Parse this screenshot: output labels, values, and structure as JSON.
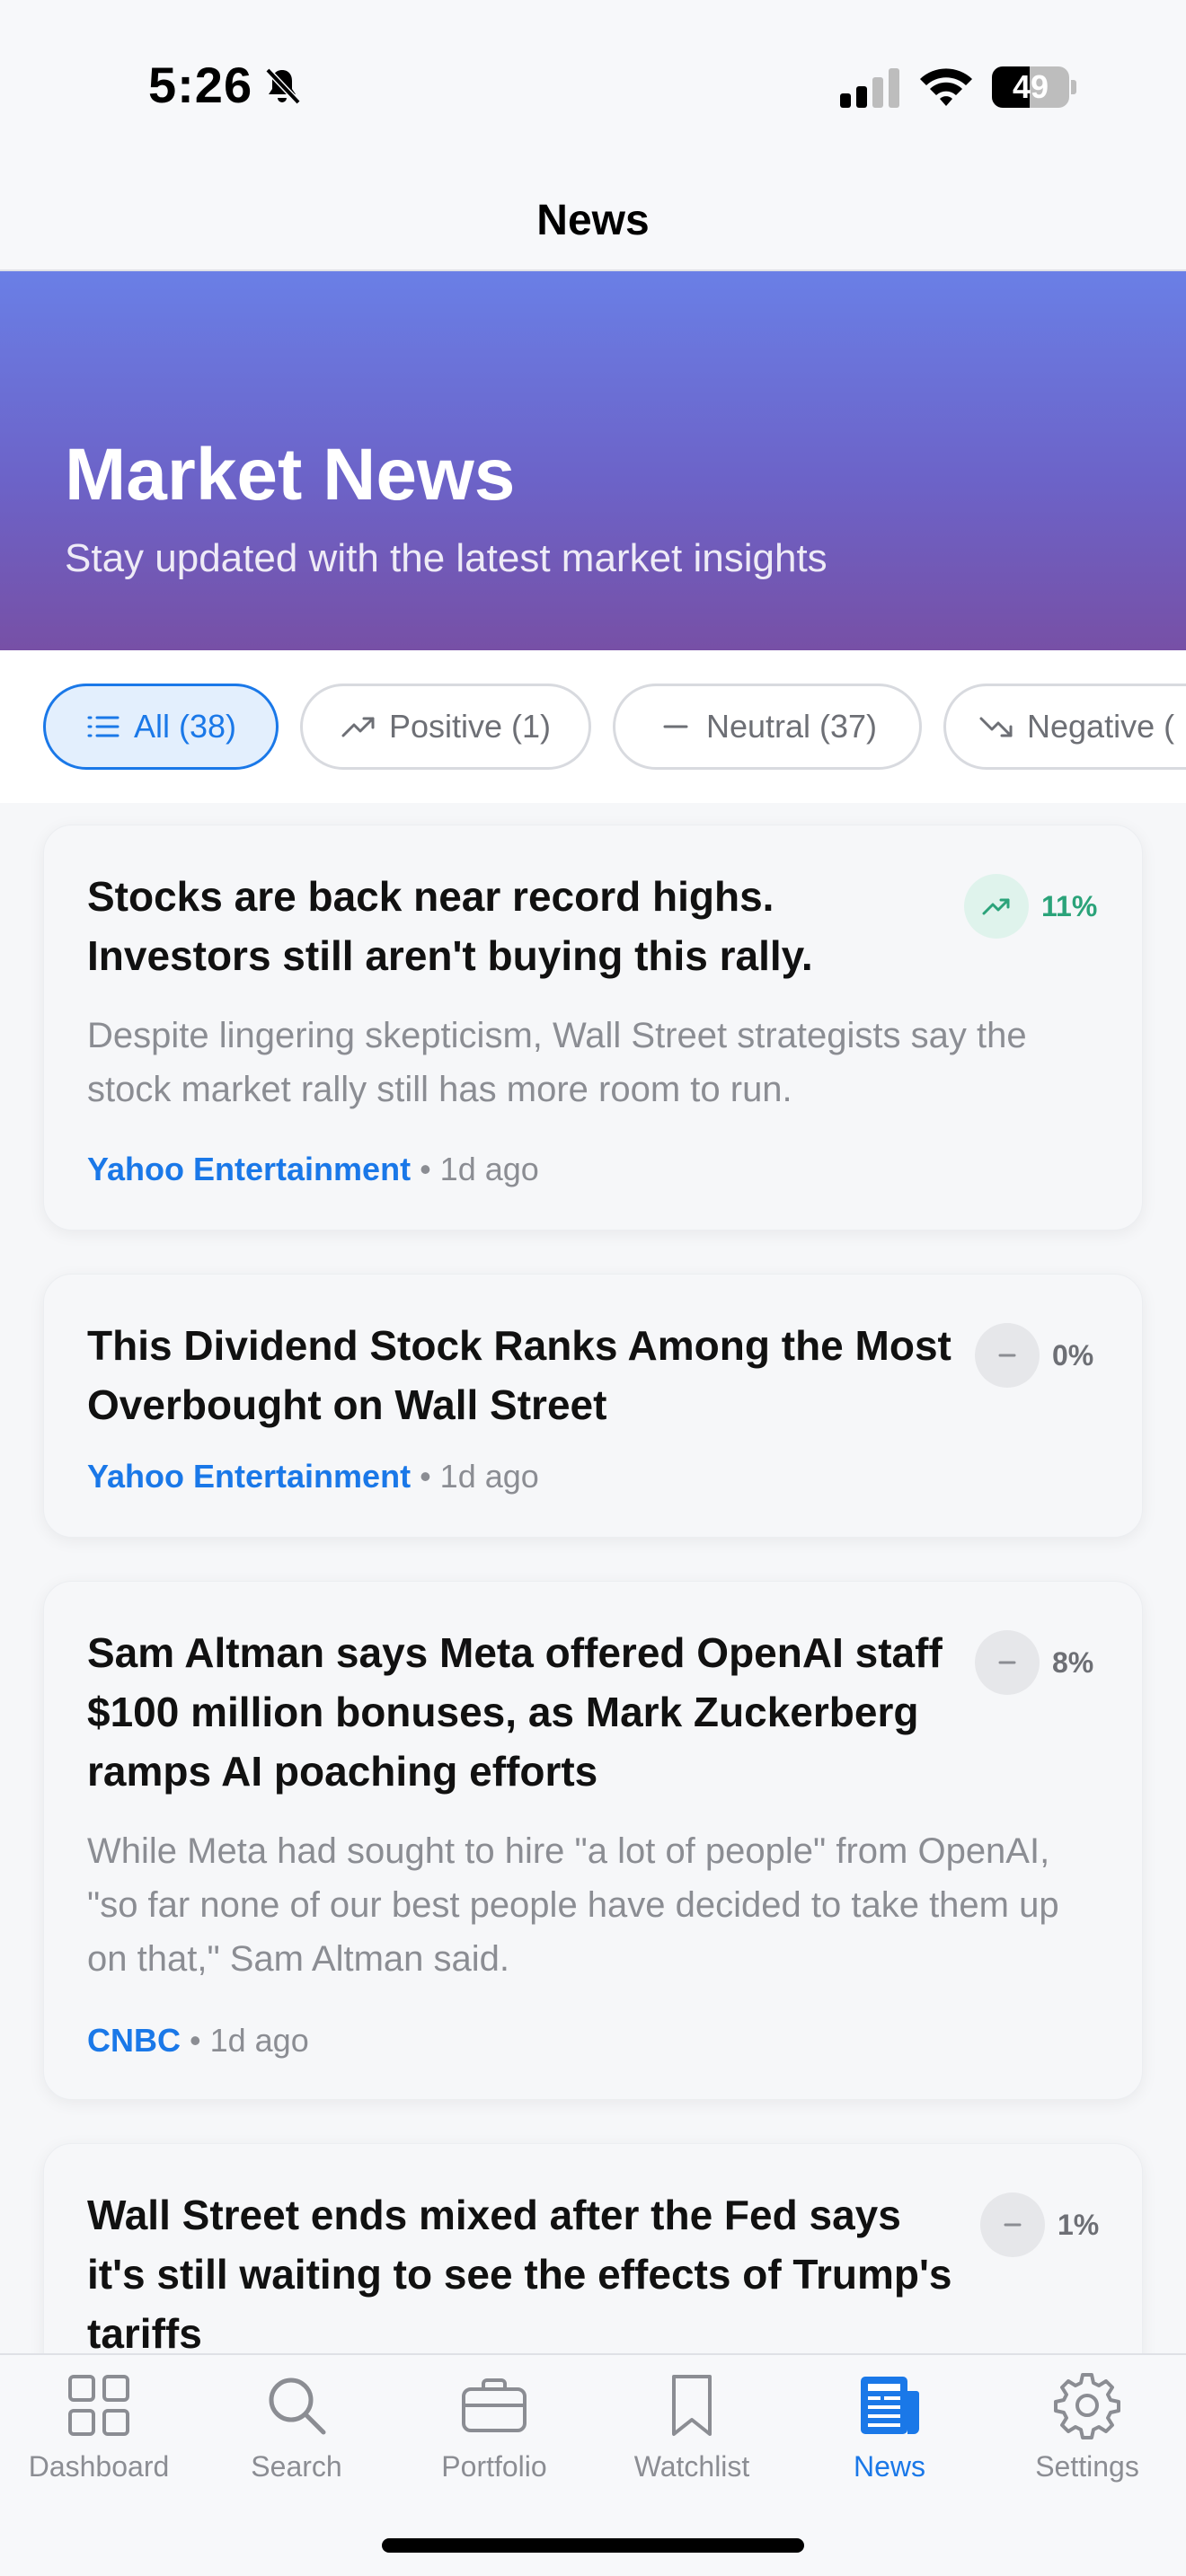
{
  "status_bar": {
    "time": "5:26",
    "battery": "49",
    "battery_level": 0.49
  },
  "nav": {
    "title": "News"
  },
  "hero": {
    "title": "Market News",
    "subtitle": "Stay updated with the latest market insights",
    "gradient_colors": [
      "#6a7fe6",
      "#7750a6"
    ]
  },
  "filters": [
    {
      "label": "All (38)",
      "icon": "list-icon",
      "active": true
    },
    {
      "label": "Positive (1)",
      "icon": "trend-up-icon",
      "active": false
    },
    {
      "label": "Neutral (37)",
      "icon": "dash-icon",
      "active": false
    },
    {
      "label": "Negative (",
      "icon": "trend-down-icon",
      "active": false
    }
  ],
  "articles": [
    {
      "title": "Stocks are back near record highs. Investors still aren't buying this rally.",
      "summary": "Despite lingering skepticism, Wall Street strategists say the stock market rally still has more room to run.",
      "source": "Yahoo Entertainment",
      "time": "1d ago",
      "sentiment": "11%",
      "sentiment_type": "positive"
    },
    {
      "title": "This Dividend Stock Ranks Among the Most Overbought on Wall Street",
      "summary": "",
      "source": "Yahoo Entertainment",
      "time": "1d ago",
      "sentiment": "0%",
      "sentiment_type": "neutral"
    },
    {
      "title": "Sam Altman says Meta offered OpenAI staff $100 million bonuses, as Mark Zuckerberg ramps AI poaching efforts",
      "summary": "While Meta had sought to hire \"a lot of people\" from OpenAI, \"so far none of our best people have decided to take them up on that,\" Sam Altman said.",
      "source": "CNBC",
      "time": "1d ago",
      "sentiment": "8%",
      "sentiment_type": "neutral"
    },
    {
      "title": "Wall Street ends mixed after the Fed says it's still waiting to see the effects of Trump's tariffs",
      "summary": "",
      "source": "",
      "time": "",
      "sentiment": "1%",
      "sentiment_type": "neutral"
    }
  ],
  "meta_separator": "•",
  "tabs": [
    {
      "label": "Dashboard",
      "icon": "grid-icon",
      "active": false
    },
    {
      "label": "Search",
      "icon": "search-icon",
      "active": false
    },
    {
      "label": "Portfolio",
      "icon": "briefcase-icon",
      "active": false
    },
    {
      "label": "Watchlist",
      "icon": "bookmark-icon",
      "active": false
    },
    {
      "label": "News",
      "icon": "newspaper-icon",
      "active": true
    },
    {
      "label": "Settings",
      "icon": "gear-icon",
      "active": false
    }
  ],
  "colors": {
    "accent": "#1a78e8",
    "positive": "#2ba37a",
    "muted": "#8b8d93"
  }
}
